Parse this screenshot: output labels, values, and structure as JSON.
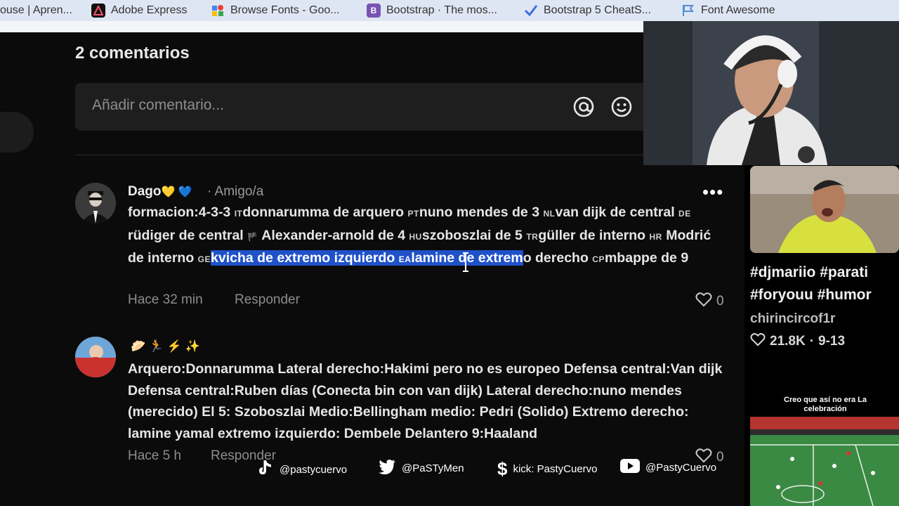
{
  "bookmarks": [
    {
      "label": "ouse | Apren...",
      "icon": "page-icon",
      "color": "#bbbbbb"
    },
    {
      "label": "Adobe Express",
      "icon": "adobe-express-icon",
      "color": "#1a1a1a"
    },
    {
      "label": "Browse Fonts - Goo...",
      "icon": "google-fonts-icon",
      "color": "#4285f4"
    },
    {
      "label": "Bootstrap · The mos...",
      "icon": "bootstrap-icon",
      "color": "#7952b3"
    },
    {
      "label": "Bootstrap 5 CheatS...",
      "icon": "checkmark-icon",
      "color": "#3b6ee0"
    },
    {
      "label": "Font Awesome",
      "icon": "flag-icon",
      "color": "#538dd7"
    }
  ],
  "comments_header": {
    "count_label": "2 comentarios"
  },
  "add_comment": {
    "placeholder": "Añadir comentario...",
    "mention_icon": "at-icon",
    "emoji_icon": "emoji-icon"
  },
  "comments": [
    {
      "username": "Dago",
      "username_emoji": "💛 💙",
      "relation": "· Amigo/a",
      "segments": {
        "s1": "formacion:4-3-3 ",
        "f1": "IT",
        "s2": "donnarumma de arquero ",
        "f2": "PT",
        "s3": "nuno mendes de 3 ",
        "f3": "NL",
        "s4": "van dijk de central ",
        "f4": "DE",
        "s5": " rüdiger de central ",
        "f5": "🏴",
        "s6": " Alexander-arnold de 4 ",
        "f6": "HU",
        "s7": "szoboszlai de 5 ",
        "f7": "TR",
        "s8": "güller de interno ",
        "f8": "HR",
        "s9": " Modrić de interno ",
        "f9": "GE",
        "h1": "kvicha de extremo izquierdo ",
        "hf": "EA",
        "h2": "lamine de extrem",
        "s10": "o derecho ",
        "f10": "CP",
        "s11": "mbappe de 9"
      },
      "time": "Hace 32 min",
      "reply_label": "Responder",
      "likes": "0",
      "more_label": "•••"
    },
    {
      "username_emoji": "🥟 🏃 ⚡ ✨",
      "text": "Arquero:Donnarumma Lateral derecho:Hakimi pero no es europeo Defensa central:Van dijk Defensa central:Ruben días (Conecta bin con van dijk) Lateral derecho:nuno mendes (merecido) El 5: Szoboszlai Medio:Bellingham medio: Pedri (Solido) Extremo derecho: lamine yamal extremo izquierdo: Dembele Delantero 9:Haaland",
      "time": "Hace 5 h",
      "reply_label": "Responder",
      "likes": "0"
    }
  ],
  "sidebar_video": {
    "hashtags": "#djmariio #parati #foryouu #humor",
    "channel": "chirincircof1r",
    "likes": "21.8K",
    "date": "9-13",
    "clip_caption": "Creo que así no era La celebración"
  },
  "socials": [
    {
      "icon": "tiktok-icon",
      "label": "@pastycuervo"
    },
    {
      "icon": "twitter-icon",
      "label": "@PaSTyMen"
    },
    {
      "icon": "dollar-icon",
      "label": "kick: PastyCuervo"
    },
    {
      "icon": "youtube-icon",
      "label": "@PastyCuervo"
    }
  ],
  "colors": {
    "highlight": "#1f51c9",
    "panel_bg": "#0b0b0b",
    "input_bg": "#1e1e1e"
  }
}
